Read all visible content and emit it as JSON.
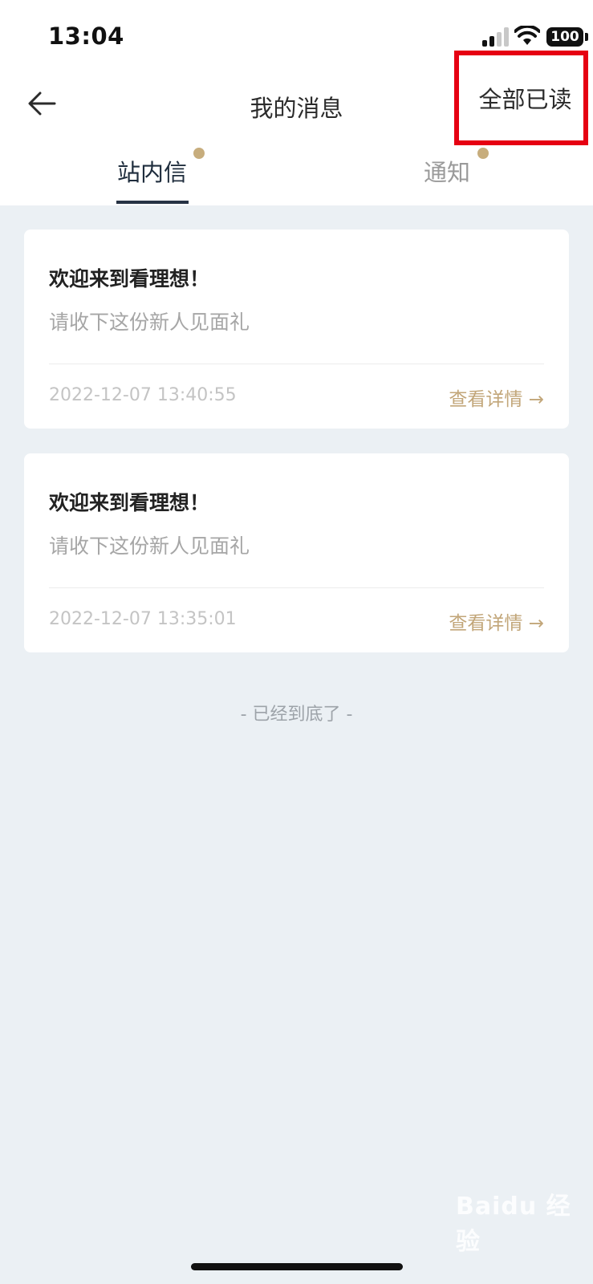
{
  "status_bar": {
    "time": "13:04",
    "battery": "100",
    "icons": [
      "signal-icon",
      "wifi-icon",
      "battery-icon"
    ]
  },
  "header": {
    "back_icon": "arrow-left-icon",
    "title": "我的消息",
    "mark_all_read": "全部已读"
  },
  "tabs": [
    {
      "label": "站内信",
      "active": true,
      "has_dot": true
    },
    {
      "label": "通知",
      "active": false,
      "has_dot": true
    }
  ],
  "messages": [
    {
      "title": "欢迎来到看理想！",
      "subtitle": "请收下这份新人见面礼",
      "time": "2022-12-07 13:40:55",
      "detail_label": "查看详情 →"
    },
    {
      "title": "欢迎来到看理想！",
      "subtitle": "请收下这份新人见面礼",
      "time": "2022-12-07 13:35:01",
      "detail_label": "查看详情 →"
    }
  ],
  "list_end": "- 已经到底了 -",
  "watermark": "Baidu 经验",
  "colors": {
    "accent": "#c7ad7d",
    "highlight_box": "#e60012",
    "background": "#ebf0f4",
    "tab_active": "#263244"
  }
}
